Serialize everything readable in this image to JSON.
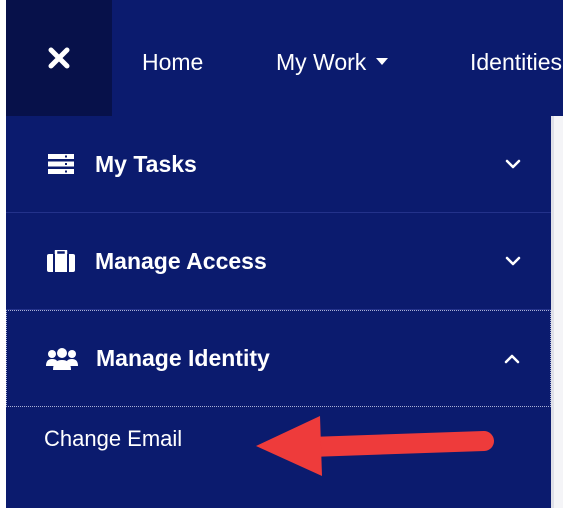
{
  "topnav": {
    "close_icon": "close-icon",
    "items": [
      {
        "label": "Home"
      },
      {
        "label": "My Work",
        "has_dropdown": true
      },
      {
        "label": "Identities"
      }
    ]
  },
  "sidebar": {
    "items": [
      {
        "label": "My Tasks",
        "icon": "tasks-list-icon",
        "expanded": false
      },
      {
        "label": "Manage Access",
        "icon": "briefcase-icon",
        "expanded": false
      },
      {
        "label": "Manage Identity",
        "icon": "users-icon",
        "expanded": true
      }
    ],
    "subitems": [
      {
        "label": "Change Email"
      }
    ]
  },
  "annotation": {
    "arrow_color": "#ee3b3b",
    "points_to": "Change Email"
  },
  "colors": {
    "nav_background": "#0b1b6e",
    "close_background": "#07114a",
    "text": "#ffffff"
  }
}
